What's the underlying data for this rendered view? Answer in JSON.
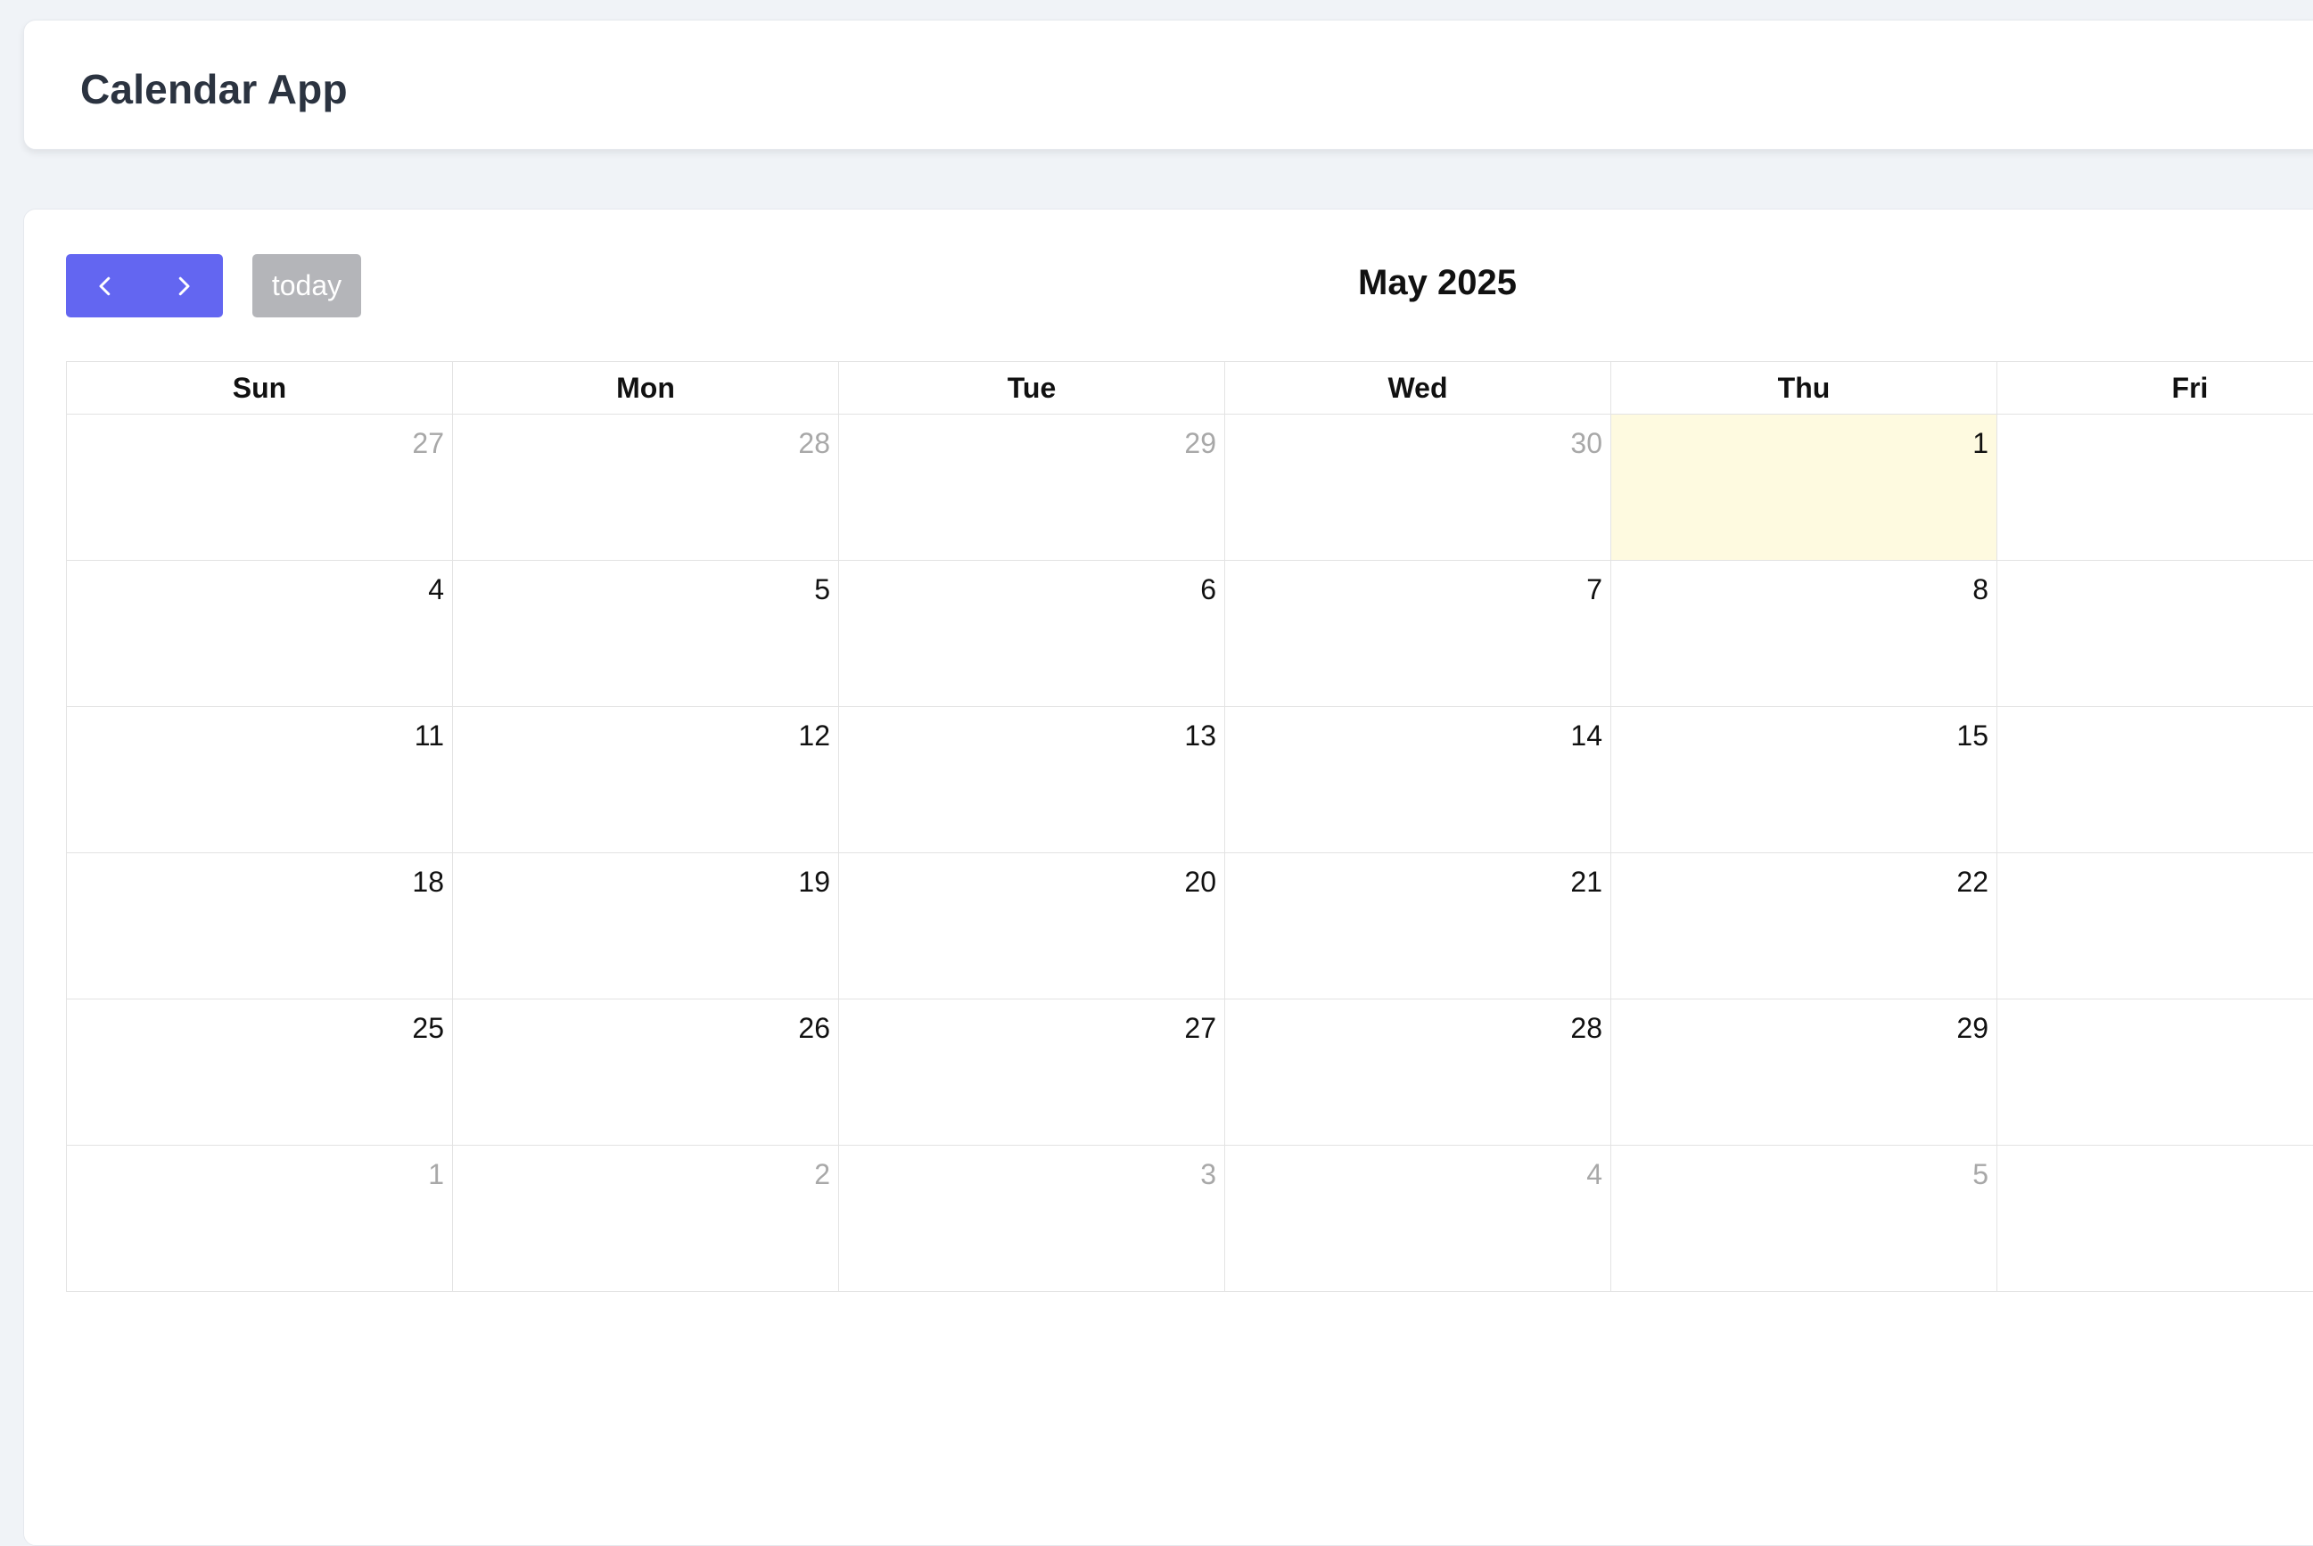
{
  "app": {
    "title": "Calendar App"
  },
  "toolbar": {
    "prev_icon": "chevron-left-icon",
    "next_icon": "chevron-right-icon",
    "today_label": "today",
    "month_title": "May 2025"
  },
  "colors": {
    "accent": "#6366f1",
    "today_button": "#b4b5b9",
    "today_highlight": "#fefae0",
    "background": "#f0f3f7"
  },
  "calendar": {
    "days_of_week": [
      "Sun",
      "Mon",
      "Tue",
      "Wed",
      "Thu",
      "Fri"
    ],
    "weeks": [
      [
        {
          "day": "27",
          "other": true
        },
        {
          "day": "28",
          "other": true
        },
        {
          "day": "29",
          "other": true
        },
        {
          "day": "30",
          "other": true
        },
        {
          "day": "1",
          "today": true
        },
        {
          "day": ""
        }
      ],
      [
        {
          "day": "4"
        },
        {
          "day": "5"
        },
        {
          "day": "6"
        },
        {
          "day": "7"
        },
        {
          "day": "8"
        },
        {
          "day": ""
        }
      ],
      [
        {
          "day": "11"
        },
        {
          "day": "12"
        },
        {
          "day": "13"
        },
        {
          "day": "14"
        },
        {
          "day": "15"
        },
        {
          "day": ""
        }
      ],
      [
        {
          "day": "18"
        },
        {
          "day": "19"
        },
        {
          "day": "20"
        },
        {
          "day": "21"
        },
        {
          "day": "22"
        },
        {
          "day": ""
        }
      ],
      [
        {
          "day": "25"
        },
        {
          "day": "26"
        },
        {
          "day": "27"
        },
        {
          "day": "28"
        },
        {
          "day": "29"
        },
        {
          "day": ""
        }
      ],
      [
        {
          "day": "1",
          "other": true
        },
        {
          "day": "2",
          "other": true
        },
        {
          "day": "3",
          "other": true
        },
        {
          "day": "4",
          "other": true
        },
        {
          "day": "5",
          "other": true
        },
        {
          "day": "",
          "other": true
        }
      ]
    ]
  }
}
